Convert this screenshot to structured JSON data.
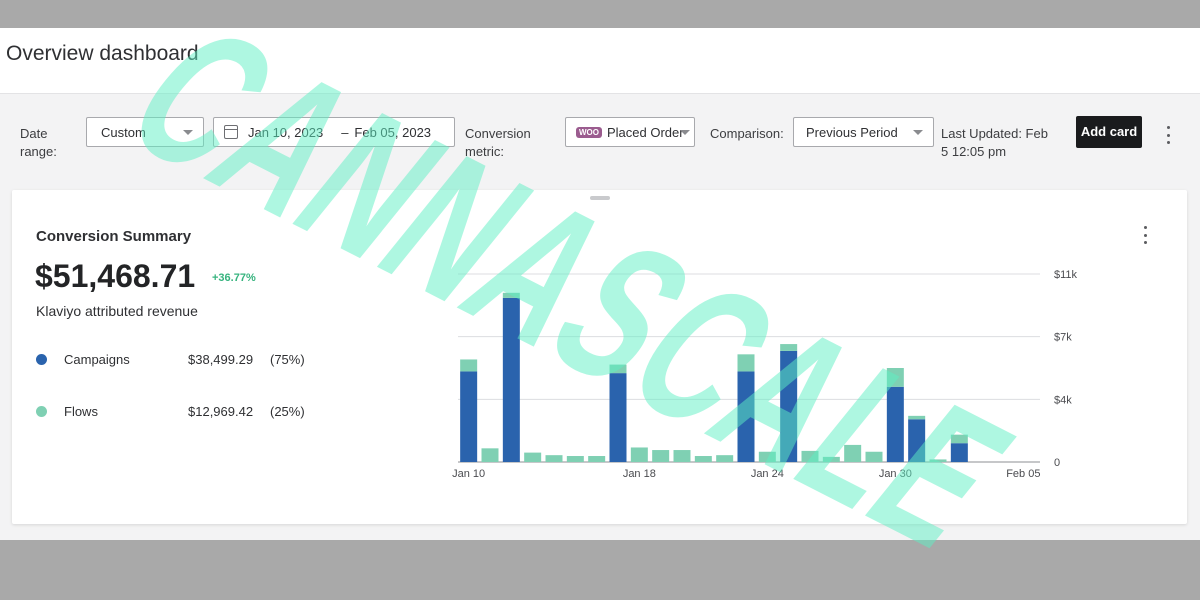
{
  "header": {
    "title": "Overview dashboard"
  },
  "filters": {
    "date_range_label_1": "Date",
    "date_range_label_2": "range:",
    "date_range_value": "Custom",
    "start_date": "Jan 10, 2023",
    "end_date": "Feb 05, 2023",
    "date_separator": "–",
    "conversion_label_1": "Conversion",
    "conversion_label_2": "metric:",
    "woo_badge": "WOO",
    "conversion_value": "Placed Order",
    "comparison_label": "Comparison:",
    "comparison_value": "Previous Period",
    "last_updated_1": "Last Updated: Feb",
    "last_updated_2": "5 12:05 pm",
    "add_card_label": "Add card"
  },
  "card": {
    "title": "Conversion Summary",
    "total": "$51,468.71",
    "delta": "+36.77%",
    "subtitle": "Klaviyo attributed revenue",
    "legend": [
      {
        "name": "Campaigns",
        "amount": "$38,499.29",
        "pct": "(75%)",
        "color": "#2a63ad"
      },
      {
        "name": "Flows",
        "amount": "$12,969.42",
        "pct": "(25%)",
        "color": "#7fd0b3"
      }
    ]
  },
  "watermark": "CANNASCALE",
  "chart_data": {
    "type": "bar",
    "stacked": true,
    "categories": [
      "Jan 10",
      "Jan 11",
      "Jan 12",
      "Jan 13",
      "Jan 14",
      "Jan 15",
      "Jan 16",
      "Jan 17",
      "Jan 18",
      "Jan 19",
      "Jan 20",
      "Jan 21",
      "Jan 22",
      "Jan 23",
      "Jan 24",
      "Jan 25",
      "Jan 26",
      "Jan 27",
      "Jan 28",
      "Jan 29",
      "Jan 30",
      "Jan 31",
      "Feb 01",
      "Feb 02",
      "Feb 03",
      "Feb 04",
      "Feb 05"
    ],
    "x_tick_labels": [
      "Jan 10",
      "Jan 18",
      "Jan 24",
      "Jan 30",
      "Feb 05"
    ],
    "y_tick_labels": [
      "$11k",
      "$7k",
      "$4k",
      "0"
    ],
    "ylim": [
      0,
      11000
    ],
    "series": [
      {
        "name": "Campaigns",
        "color": "#2a63ad",
        "values": [
          5300,
          0,
          9600,
          0,
          0,
          0,
          0,
          5200,
          0,
          0,
          0,
          0,
          0,
          5300,
          0,
          6500,
          0,
          0,
          0,
          0,
          4400,
          2500,
          0,
          1100,
          0,
          0,
          0
        ]
      },
      {
        "name": "Flows",
        "color": "#7fd0b3",
        "values": [
          700,
          800,
          300,
          550,
          400,
          350,
          350,
          500,
          850,
          700,
          700,
          350,
          400,
          1000,
          600,
          400,
          650,
          300,
          1000,
          600,
          1100,
          200,
          150,
          500,
          0,
          0,
          0
        ]
      }
    ],
    "legend": "left",
    "grid": true
  }
}
